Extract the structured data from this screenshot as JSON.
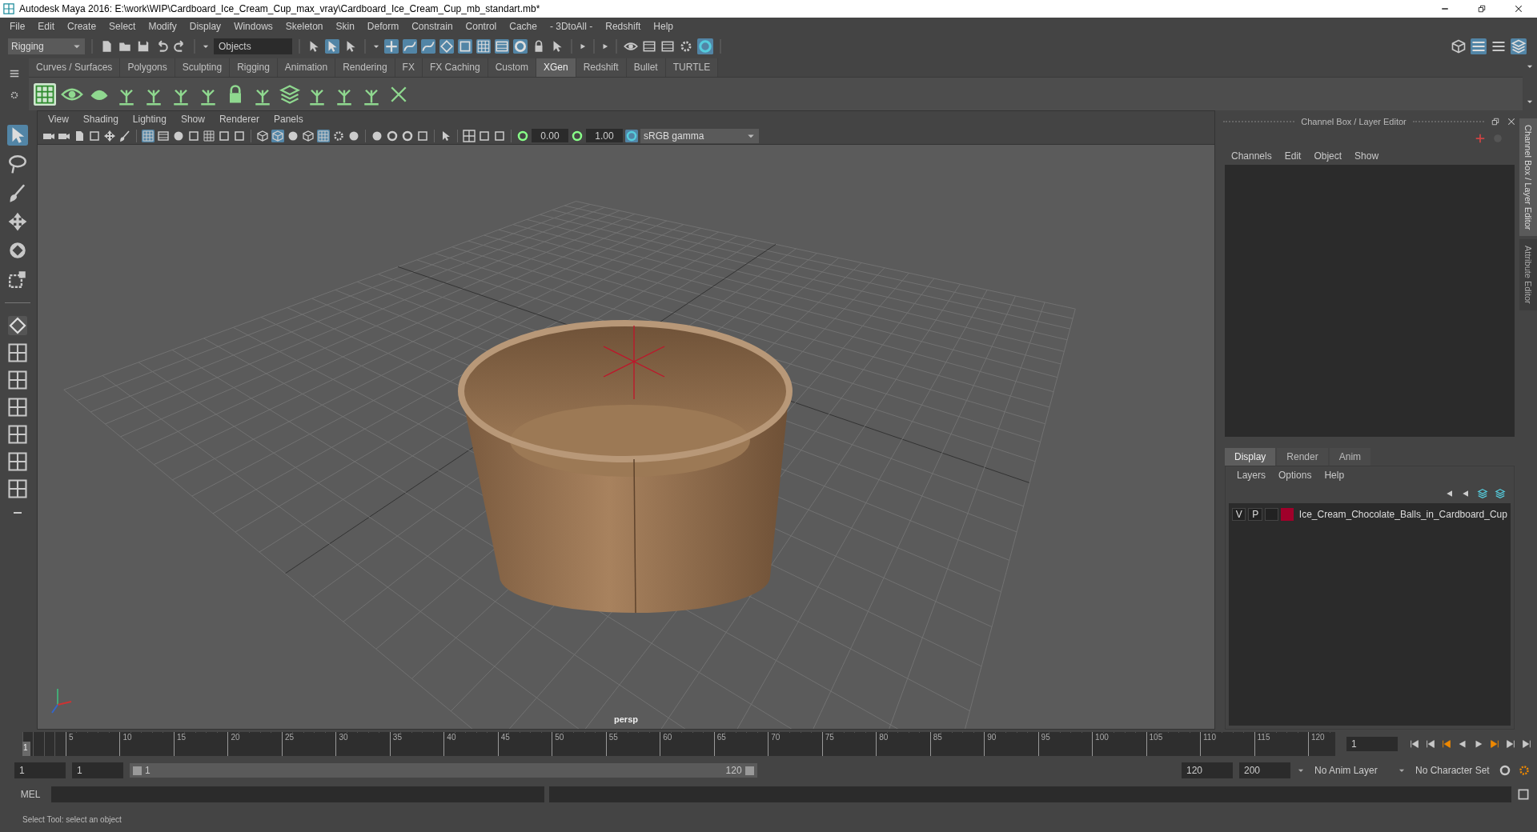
{
  "window": {
    "title": "Autodesk Maya 2016: E:\\work\\WIP\\Cardboard_Ice_Cream_Cup_max_vray\\Cardboard_Ice_Cream_Cup_mb_standart.mb*"
  },
  "menu_bar": [
    "File",
    "Edit",
    "Create",
    "Select",
    "Modify",
    "Display",
    "Windows",
    "Skeleton",
    "Skin",
    "Deform",
    "Constrain",
    "Control",
    "Cache",
    "- 3DtoAll -",
    "Redshift",
    "Help"
  ],
  "status_line": {
    "menu_set": "Rigging",
    "selection_field": "Objects"
  },
  "shelf_tabs": [
    {
      "label": "Curves / Surfaces",
      "selected": false
    },
    {
      "label": "Polygons",
      "selected": false
    },
    {
      "label": "Sculpting",
      "selected": false
    },
    {
      "label": "Rigging",
      "selected": false
    },
    {
      "label": "Animation",
      "selected": false
    },
    {
      "label": "Rendering",
      "selected": false
    },
    {
      "label": "FX",
      "selected": false
    },
    {
      "label": "FX Caching",
      "selected": false
    },
    {
      "label": "Custom",
      "selected": false
    },
    {
      "label": "XGen",
      "selected": true
    },
    {
      "label": "Redshift",
      "selected": false
    },
    {
      "label": "Bullet",
      "selected": false
    },
    {
      "label": "TURTLE",
      "selected": false
    }
  ],
  "viewport": {
    "menus": [
      "View",
      "Shading",
      "Lighting",
      "Show",
      "Renderer",
      "Panels"
    ],
    "exposure": "0.00",
    "gamma": "1.00",
    "color_space": "sRGB gamma",
    "camera": "persp"
  },
  "channel_box": {
    "title": "Channel Box / Layer Editor",
    "menus": [
      "Channels",
      "Edit",
      "Object",
      "Show"
    ]
  },
  "layer_editor": {
    "tabs": [
      {
        "label": "Display",
        "selected": true
      },
      {
        "label": "Render",
        "selected": false
      },
      {
        "label": "Anim",
        "selected": false
      }
    ],
    "menus": [
      "Layers",
      "Options",
      "Help"
    ],
    "layers": [
      {
        "visible": "V",
        "playback": "P",
        "color": "#a0002a",
        "name": "Ice_Cream_Chocolate_Balls_in_Cardboard_Cup"
      }
    ]
  },
  "side_tabs": [
    {
      "label": "Channel Box / Layer Editor",
      "selected": true
    },
    {
      "label": "Attribute Editor",
      "selected": false
    }
  ],
  "time_slider": {
    "current": "1",
    "ticks": [
      "5",
      "10",
      "15",
      "20",
      "25",
      "30",
      "35",
      "40",
      "45",
      "50",
      "55",
      "60",
      "65",
      "70",
      "75",
      "80",
      "85",
      "90",
      "95",
      "100",
      "105",
      "110",
      "115",
      "120"
    ],
    "current_field": "1"
  },
  "range_slider": {
    "start": "1",
    "playback_start": "1",
    "range_start": "1",
    "range_end": "120",
    "playback_end": "120",
    "end": "200",
    "anim_layer": "No Anim Layer",
    "character_set": "No Character Set"
  },
  "command_line": {
    "label": "MEL"
  },
  "help_line": "Select Tool: select an object"
}
